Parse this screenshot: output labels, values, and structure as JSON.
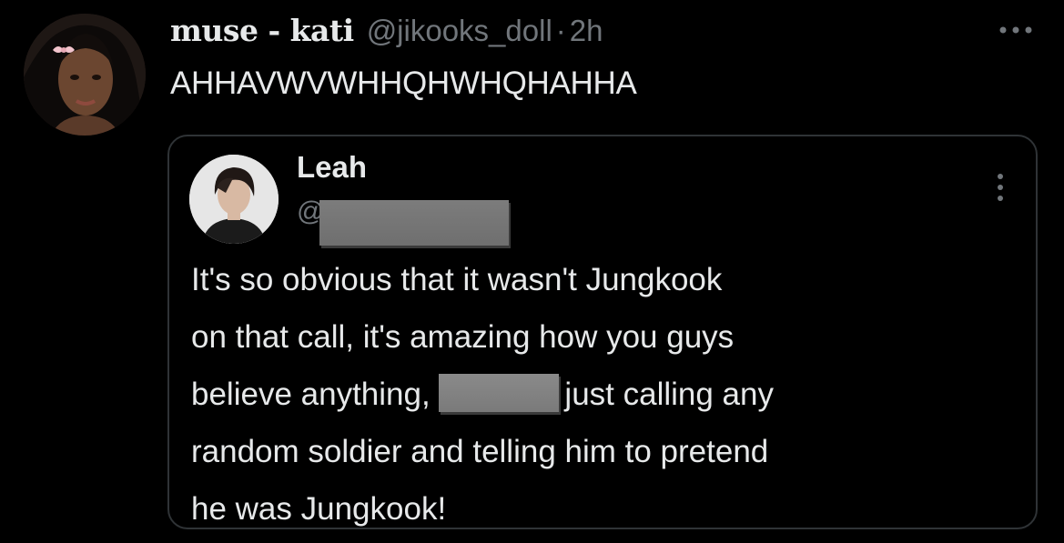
{
  "tweet": {
    "display_name": "muse - kati",
    "handle": "@jikooks_doll",
    "separator": "·",
    "time": "2h",
    "text": "AHHAVWVWHHQHWHQHAHHA",
    "avatar_icon": "profile-photo",
    "more_icon": "more-horizontal-icon"
  },
  "quoted": {
    "display_name": "Leah",
    "handle_prefix": "@",
    "avatar_icon": "profile-photo",
    "more_icon": "more-vertical-icon",
    "lines": {
      "l1": "It's so obvious that it wasn't Jungkook",
      "l2": "on that call, it's amazing how you guys",
      "l3a": "believe anything, ",
      "l3b": "just calling any",
      "l4": "random soldier and telling him to pretend",
      "l5": "he was Jungkook!"
    }
  },
  "colors": {
    "background": "#000000",
    "text_primary": "#e7e9ea",
    "text_secondary": "#71767b",
    "border": "#2f3336",
    "redaction": "#7a7a7a"
  }
}
